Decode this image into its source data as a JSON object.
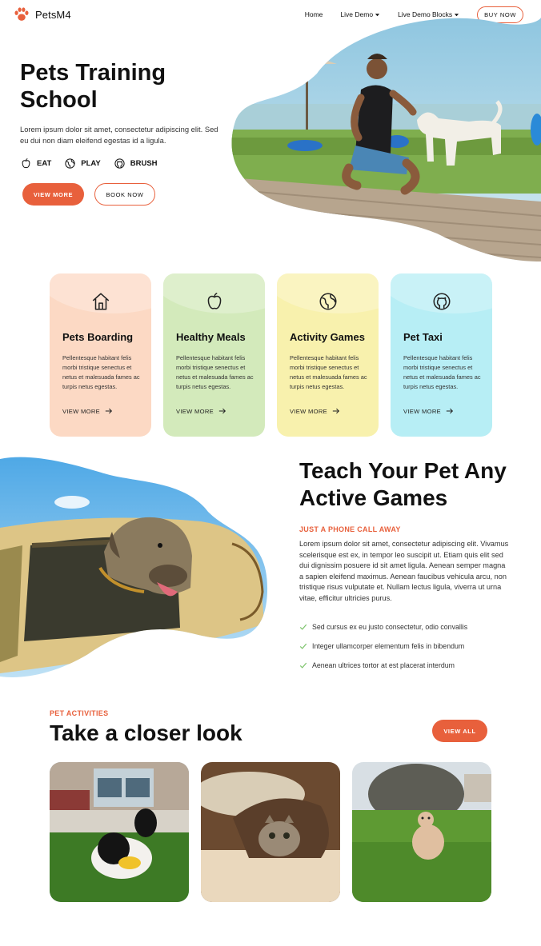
{
  "header": {
    "brand": "PetsM4",
    "nav": [
      {
        "label": "Home",
        "has_caret": false
      },
      {
        "label": "Live Demo",
        "has_caret": true
      },
      {
        "label": "Live Demo Blocks",
        "has_caret": true
      }
    ],
    "buy_now": "BUY NOW"
  },
  "hero": {
    "title": "Pets Training School",
    "description": "Lorem ipsum dolor sit amet, consectetur adipiscing elit. Sed eu dui non diam eleifend egestas id a ligula.",
    "features": [
      {
        "label": "EAT",
        "icon": "apple-icon"
      },
      {
        "label": "PLAY",
        "icon": "globe-icon"
      },
      {
        "label": "BRUSH",
        "icon": "github-icon"
      }
    ],
    "primary_button": "VIEW MORE",
    "secondary_button": "BOOK NOW"
  },
  "services": [
    {
      "title": "Pets Boarding",
      "icon": "home-icon",
      "color": "#fcd9c4",
      "text": "Pellentesque habitant felis morbi tristique senectus et netus et malesuada fames ac turpis netus egestas.",
      "link": "VIEW MORE"
    },
    {
      "title": "Healthy Meals",
      "icon": "apple-icon",
      "color": "#d3eabb",
      "text": "Pellentesque habitant felis morbi tristique senectus et netus et malesuada fames ac turpis netus egestas.",
      "link": "VIEW MORE"
    },
    {
      "title": "Activity Games",
      "icon": "globe-icon",
      "color": "#f8f1ad",
      "text": "Pellentesque habitant felis morbi tristique senectus et netus et malesuada fames ac turpis netus egestas.",
      "link": "VIEW MORE"
    },
    {
      "title": "Pet Taxi",
      "icon": "github-icon",
      "color": "#b7eef5",
      "text": "Pellentesque habitant felis morbi tristique senectus et netus et malesuada fames ac turpis netus egestas.",
      "link": "VIEW MORE"
    }
  ],
  "games": {
    "title": "Teach Your Pet Any Active Games",
    "subtitle": "JUST A PHONE CALL AWAY",
    "body": "Lorem ipsum dolor sit amet, consectetur adipiscing elit. Vivamus scelerisque est ex, in tempor leo suscipit ut. Etiam quis elit sed dui dignissim posuere id sit amet ligula. Aenean semper magna a sapien eleifend maximus. Aenean faucibus vehicula arcu, non tristique risus vulputate et. Nullam lectus ligula, viverra ut urna vitae, efficitur ultricies purus.",
    "checklist": [
      "Sed cursus ex eu justo consectetur, odio convallis",
      "Integer ullamcorper elementum felis in bibendum",
      "Aenean ultrices tortor at est placerat interdum"
    ]
  },
  "activities": {
    "label": "PET ACTIVITIES",
    "title": "Take a closer look",
    "view_all": "VIEW ALL"
  },
  "colors": {
    "accent": "#e8603c",
    "check": "#7cc36b",
    "text": "#111111"
  }
}
